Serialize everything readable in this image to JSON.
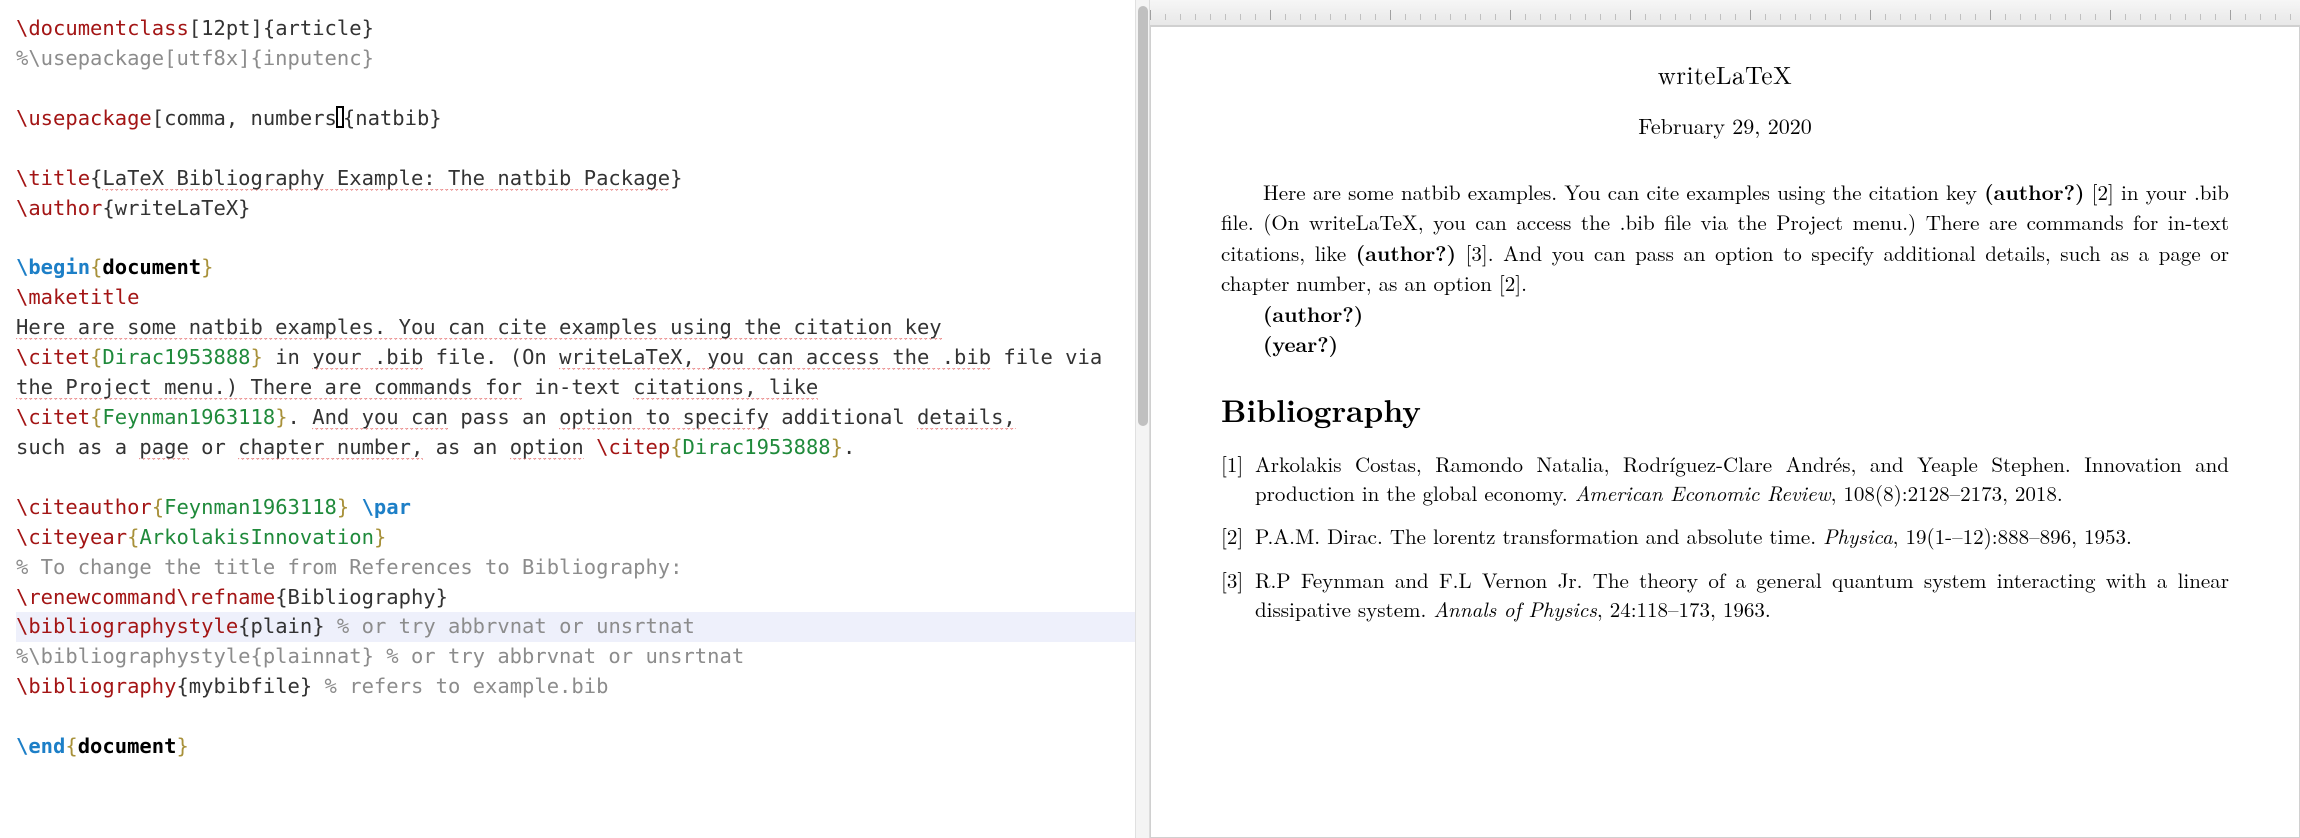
{
  "editor": {
    "lines": [
      {
        "segs": [
          {
            "t": "\\documentclass",
            "c": "cmd"
          },
          {
            "t": "[12pt]{article}",
            "c": "txt"
          }
        ]
      },
      {
        "segs": [
          {
            "t": "%\\usepackage[utf8x]{inputenc}",
            "c": "cmt"
          }
        ]
      },
      {
        "segs": [
          {
            "t": "",
            "c": "txt"
          }
        ]
      },
      {
        "segs": [
          {
            "t": "\\usepackage",
            "c": "cmd"
          },
          {
            "t": "[comma, numbers",
            "c": "txt"
          },
          {
            "t": "CURSOR",
            "c": "cursor"
          },
          {
            "t": "{natbib}",
            "c": "txt"
          }
        ]
      },
      {
        "segs": [
          {
            "t": "",
            "c": "txt"
          }
        ]
      },
      {
        "segs": [
          {
            "t": "\\title",
            "c": "cmd"
          },
          {
            "t": "{",
            "c": "txt"
          },
          {
            "t": "LaTeX Bibliography Example: The natbib Package",
            "c": "txt",
            "squig": true
          },
          {
            "t": "}",
            "c": "txt"
          }
        ]
      },
      {
        "segs": [
          {
            "t": "\\author",
            "c": "cmd"
          },
          {
            "t": "{writeLaTeX}",
            "c": "txt"
          }
        ]
      },
      {
        "segs": [
          {
            "t": "",
            "c": "txt"
          }
        ]
      },
      {
        "segs": [
          {
            "t": "\\begin",
            "c": "blue"
          },
          {
            "t": "{",
            "c": "brace"
          },
          {
            "t": "document",
            "c": "docbf"
          },
          {
            "t": "}",
            "c": "brace"
          }
        ]
      },
      {
        "segs": [
          {
            "t": "\\maketitle",
            "c": "cmd"
          }
        ]
      },
      {
        "segs": [
          {
            "t": "Here are some natbib examples. You can cite examples using the citation key",
            "c": "txt",
            "squig": true
          }
        ]
      },
      {
        "segs": [
          {
            "t": "\\citet",
            "c": "cmd"
          },
          {
            "t": "{",
            "c": "brace"
          },
          {
            "t": "Dirac1953888",
            "c": "key"
          },
          {
            "t": "}",
            "c": "brace"
          },
          {
            "t": " in ",
            "c": "txt"
          },
          {
            "t": "your .bib",
            "c": "txt",
            "squig": true
          },
          {
            "t": " file. (On ",
            "c": "txt"
          },
          {
            "t": "writeLaTeX, you can access the .bib",
            "c": "txt",
            "squig": true
          },
          {
            "t": " file via",
            "c": "txt"
          }
        ]
      },
      {
        "segs": [
          {
            "t": "the Project menu.) There are commands for",
            "c": "txt",
            "squig": true
          },
          {
            "t": " in-text ",
            "c": "txt"
          },
          {
            "t": "citations, like",
            "c": "txt",
            "squig": true
          }
        ]
      },
      {
        "segs": [
          {
            "t": "\\citet",
            "c": "cmd"
          },
          {
            "t": "{",
            "c": "brace"
          },
          {
            "t": "Feynman1963118",
            "c": "key"
          },
          {
            "t": "}",
            "c": "brace"
          },
          {
            "t": ". ",
            "c": "txt"
          },
          {
            "t": "And you can",
            "c": "txt",
            "squig": true
          },
          {
            "t": " pass an ",
            "c": "txt"
          },
          {
            "t": "option to specify",
            "c": "txt",
            "squig": true
          },
          {
            "t": " additional ",
            "c": "txt"
          },
          {
            "t": "details,",
            "c": "txt",
            "squig": true
          }
        ]
      },
      {
        "segs": [
          {
            "t": "such as a ",
            "c": "txt"
          },
          {
            "t": "page",
            "c": "txt",
            "squig": true
          },
          {
            "t": " or ",
            "c": "txt"
          },
          {
            "t": "chapter number,",
            "c": "txt",
            "squig": true
          },
          {
            "t": " as an ",
            "c": "txt"
          },
          {
            "t": "option",
            "c": "txt",
            "squig": true
          },
          {
            "t": " ",
            "c": "txt"
          },
          {
            "t": "\\citep",
            "c": "cmd"
          },
          {
            "t": "{",
            "c": "brace"
          },
          {
            "t": "Dirac1953888",
            "c": "key"
          },
          {
            "t": "}",
            "c": "brace"
          },
          {
            "t": ".",
            "c": "txt"
          }
        ]
      },
      {
        "segs": [
          {
            "t": "",
            "c": "txt"
          }
        ]
      },
      {
        "segs": [
          {
            "t": "\\citeauthor",
            "c": "cmd"
          },
          {
            "t": "{",
            "c": "brace"
          },
          {
            "t": "Feynman1963118",
            "c": "key"
          },
          {
            "t": "}",
            "c": "brace"
          },
          {
            "t": " ",
            "c": "txt"
          },
          {
            "t": "\\par",
            "c": "blue"
          }
        ]
      },
      {
        "segs": [
          {
            "t": "\\citeyear",
            "c": "cmd"
          },
          {
            "t": "{",
            "c": "brace"
          },
          {
            "t": "ArkolakisInnovation",
            "c": "key"
          },
          {
            "t": "}",
            "c": "brace"
          }
        ]
      },
      {
        "segs": [
          {
            "t": "% To change the title from References to Bibliography:",
            "c": "cmt"
          }
        ]
      },
      {
        "segs": [
          {
            "t": "\\renewcommand\\refname",
            "c": "cmd"
          },
          {
            "t": "{Bibliography}",
            "c": "txt"
          }
        ]
      },
      {
        "hl": true,
        "segs": [
          {
            "t": "\\bibliographystyle",
            "c": "cmd"
          },
          {
            "t": "{plain}",
            "c": "txt"
          },
          {
            "t": " % or try abbrvnat or unsrtnat",
            "c": "cmt"
          }
        ]
      },
      {
        "segs": [
          {
            "t": "%\\bibliographystyle{plainnat} % or try abbrvnat or unsrtnat",
            "c": "cmt"
          }
        ]
      },
      {
        "segs": [
          {
            "t": "\\bibliography",
            "c": "cmd"
          },
          {
            "t": "{mybibfile}",
            "c": "txt"
          },
          {
            "t": " % refers to example.bib",
            "c": "cmt"
          }
        ]
      },
      {
        "segs": [
          {
            "t": "",
            "c": "txt"
          }
        ]
      },
      {
        "segs": [
          {
            "t": "\\end",
            "c": "blue"
          },
          {
            "t": "{",
            "c": "brace"
          },
          {
            "t": "document",
            "c": "docbf"
          },
          {
            "t": "}",
            "c": "brace"
          }
        ]
      }
    ]
  },
  "preview": {
    "title": "writeLaTeX",
    "date": "February 29, 2020",
    "para": [
      {
        "t": "Here are some natbib examples.  You can cite examples using the citation key "
      },
      {
        "t": "(author?)",
        "b": true
      },
      {
        "t": " [2] in your .bib file.  (On writeLaTeX, you can access the .bib file via the Project menu.)  There are commands for in-text citations, like "
      },
      {
        "t": "(author?)",
        "b": true
      },
      {
        "t": " [3].  And you can pass an option to specify additional details, such as a page or chapter number, as an option [2]."
      }
    ],
    "q1": "(author?)",
    "q2": "(year?)",
    "bib_heading": "Bibliography",
    "bib": [
      {
        "n": "[1]",
        "parts": [
          {
            "t": "Arkolakis Costas, Ramondo Natalia, Rodríguez-Clare Andrés, and Yeaple Stephen.  Innovation and production in the global economy.  "
          },
          {
            "t": "American Economic Review",
            "i": true
          },
          {
            "t": ", 108(8):2128–2173, 2018."
          }
        ]
      },
      {
        "n": "[2]",
        "parts": [
          {
            "t": "P.A.M. Dirac.  The lorentz transformation and absolute time.  "
          },
          {
            "t": "Physica",
            "i": true
          },
          {
            "t": ", 19(1-–12):888–896, 1953."
          }
        ]
      },
      {
        "n": "[3]",
        "parts": [
          {
            "t": "R.P Feynman and F.L Vernon Jr.  The theory of a general quantum system interacting with a linear dissipative system.  "
          },
          {
            "t": "Annals of Physics",
            "i": true
          },
          {
            "t": ", 24:118–173, 1963."
          }
        ]
      }
    ]
  }
}
